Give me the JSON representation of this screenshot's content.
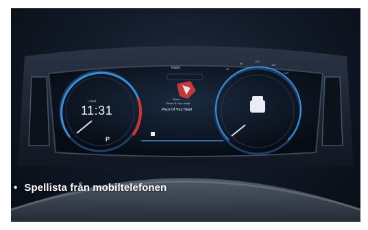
{
  "cluster": {
    "clock": "11:31",
    "clock_label": "Lokal",
    "media_artist": "Pixies",
    "media_song": "Piece Of Your Heart",
    "media_title": "Piece Of Your Heart",
    "source_label": "Radio",
    "gear": "P",
    "speed_ticks": [
      "20",
      "40",
      "60",
      "80",
      "100",
      "120",
      "140",
      "160",
      "180",
      "200",
      "220"
    ]
  },
  "caption": {
    "bullet": "•",
    "text": "Spellista från mobiltelefonen"
  },
  "colors": {
    "accent_red": "#d9312b",
    "gauge_blue": "#3a8fd9"
  }
}
